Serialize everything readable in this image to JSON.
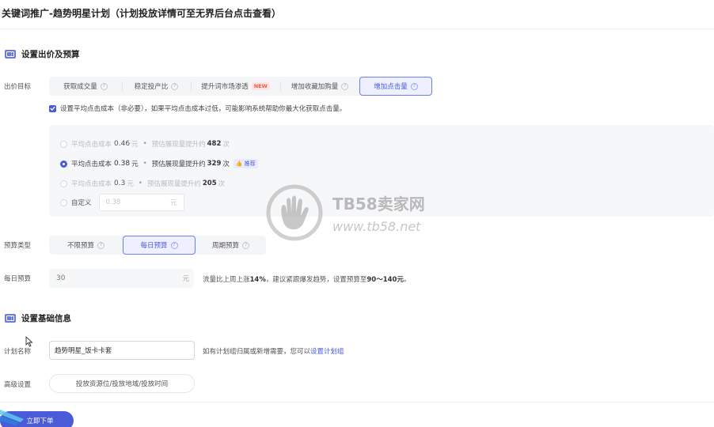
{
  "page": {
    "title": "关键词推广-趋势明星计划（计划投放详情可至无界后台点击查看）"
  },
  "bid_section": {
    "heading": "设置出价及预算",
    "target": {
      "label": "出价目标",
      "options": [
        {
          "label": "获取成交量",
          "badge": ""
        },
        {
          "label": "稳定投产比",
          "badge": ""
        },
        {
          "label": "提升词市场渗透",
          "badge": "NEW"
        },
        {
          "label": "增加收藏加购量",
          "badge": ""
        },
        {
          "label": "增加点击量",
          "badge": ""
        }
      ],
      "selected": "增加点击量"
    },
    "avg_cost_checkbox": {
      "checked": true,
      "text": "设置平均点击成本（非必要），如果平均点击成本过低，可能影响系统帮助你最大化获取点击量。"
    },
    "cost_options": [
      {
        "label": "平均点击成本",
        "value": "0.46",
        "unit": "元",
        "lift_label": "预估展现量提升约",
        "lift_value": "482",
        "lift_unit": "次",
        "selected": false,
        "recommended": false
      },
      {
        "label": "平均点击成本",
        "value": "0.38",
        "unit": "元",
        "lift_label": "预估展现量提升约",
        "lift_value": "329",
        "lift_unit": "次",
        "selected": true,
        "recommended": true,
        "recommend_label": "推荐"
      },
      {
        "label": "平均点击成本",
        "value": "0.3",
        "unit": "元",
        "lift_label": "预估展现量提升约",
        "lift_value": "205",
        "lift_unit": "次",
        "selected": false,
        "recommended": false
      }
    ],
    "custom": {
      "label": "自定义",
      "placeholder": "0.38",
      "unit": "元"
    },
    "budget_type": {
      "label": "预算类型",
      "options": [
        "不限预算",
        "每日预算",
        "周期预算"
      ],
      "selected": "每日预算"
    },
    "daily_budget": {
      "label": "每日预算",
      "value": "30",
      "unit": "元",
      "hint_prefix": "流量比上周上涨",
      "hint_percent": "14%",
      "hint_middle": "，建议紧跟爆发趋势，设置预算至",
      "hint_range": "90～140元",
      "hint_suffix": "。"
    }
  },
  "basic_section": {
    "heading": "设置基础信息",
    "plan_name": {
      "label": "计划名称",
      "value": "趋势明星_饭卡卡套",
      "hint": "如有计划组归属或新增需要，您可以",
      "hint_link": "设置计划组"
    },
    "advanced": {
      "label": "高级设置",
      "button": "投放资源位/投放地域/投放时间"
    }
  },
  "submit": {
    "label": "立即下单"
  },
  "watermark": {
    "brand": "TB58卖家网",
    "url": "www.tb58.net"
  },
  "colors": {
    "accent": "#4a5bd8",
    "new_badge": "#f05a4a"
  }
}
